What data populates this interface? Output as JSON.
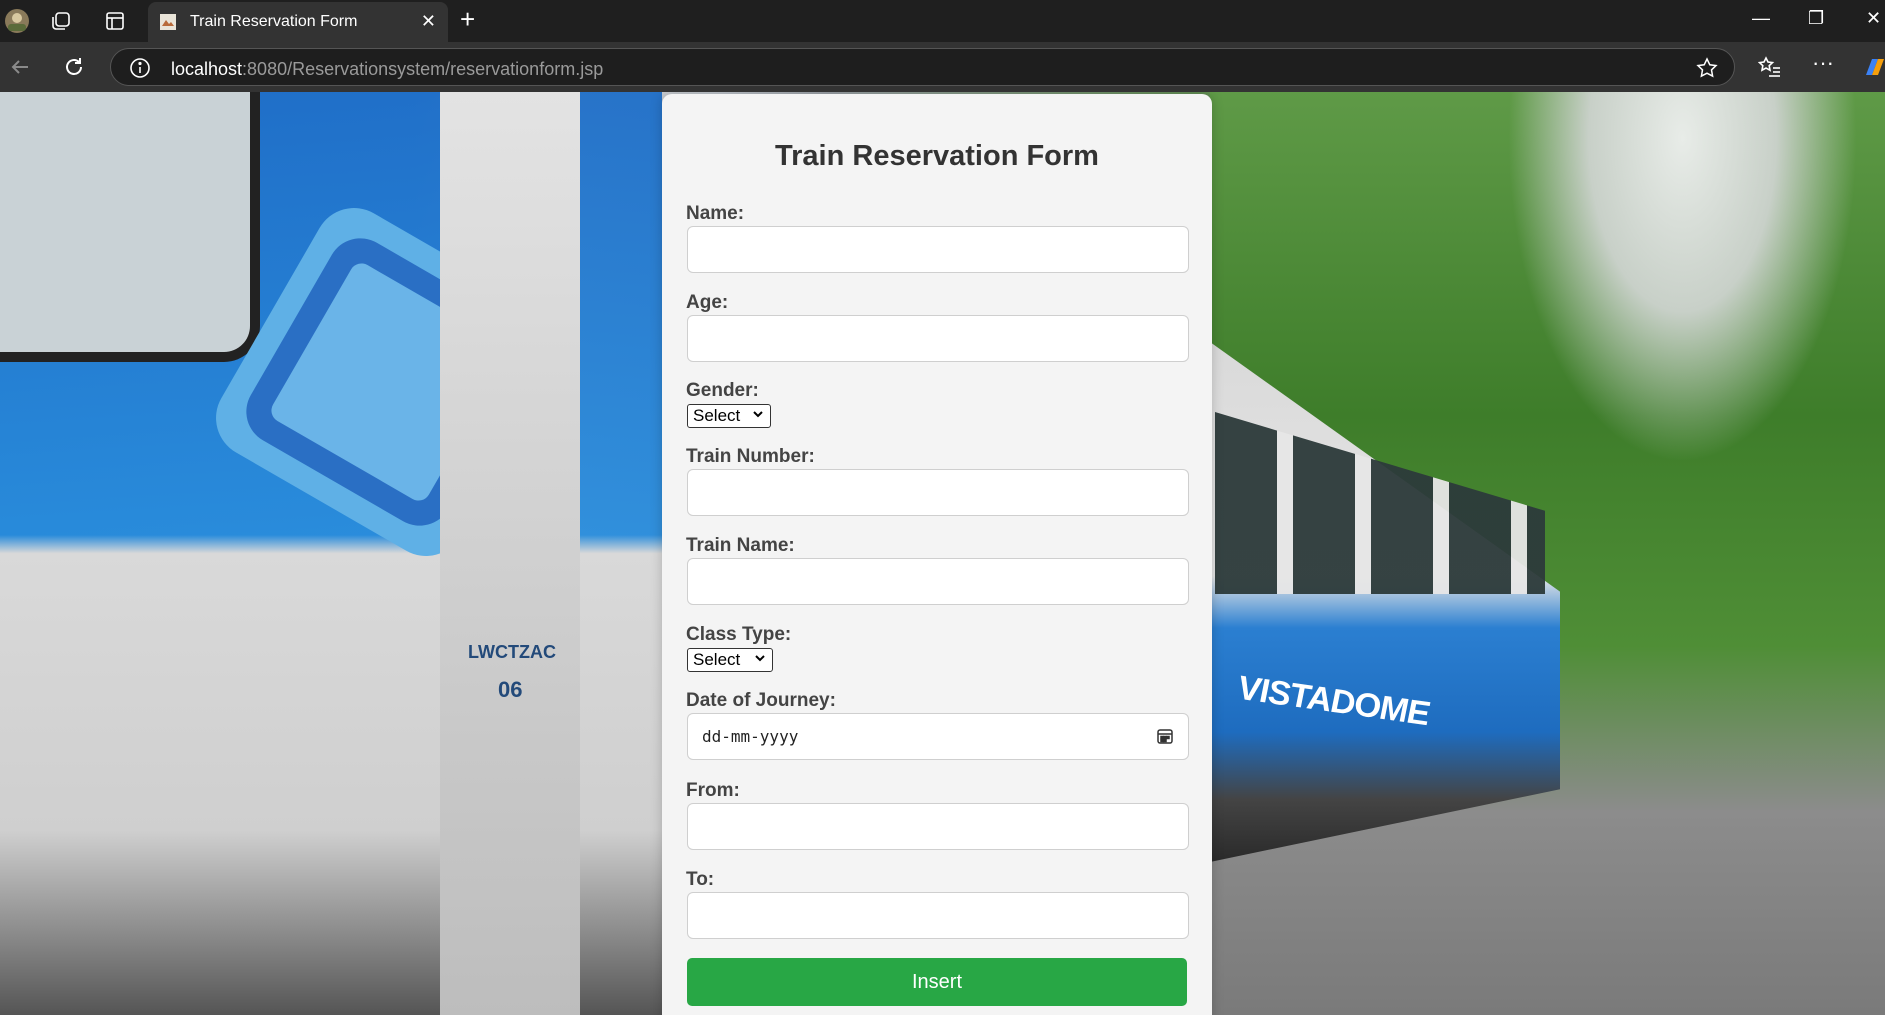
{
  "browser": {
    "tab_title": "Train Reservation Form",
    "url_host": "localhost",
    "url_path": ":8080/Reservationsystem/reservationform.jsp",
    "tab_close": "✕",
    "new_tab": "+",
    "minimize": "—",
    "restore": "❐",
    "window_close": "✕",
    "more": "···"
  },
  "background": {
    "left_tag": "LWCTZAC",
    "left_tag_number": "06",
    "right_brand": "VISTADOME"
  },
  "form": {
    "title": "Train Reservation Form",
    "name_label": "Name:",
    "name_value": "",
    "age_label": "Age:",
    "age_value": "",
    "gender_label": "Gender:",
    "gender_selected": "Select",
    "train_number_label": "Train Number:",
    "train_number_value": "",
    "train_name_label": "Train Name:",
    "train_name_value": "",
    "class_type_label": "Class Type:",
    "class_type_selected": "Select",
    "date_label": "Date of Journey:",
    "date_placeholder": "dd-mm-yyyy",
    "from_label": "From:",
    "from_value": "",
    "to_label": "To:",
    "to_value": "",
    "submit_label": "Insert"
  },
  "colors": {
    "submit_button": "#28a745",
    "panel_background": "#f4f4f4",
    "browser_chrome": "#1f1f1f"
  }
}
